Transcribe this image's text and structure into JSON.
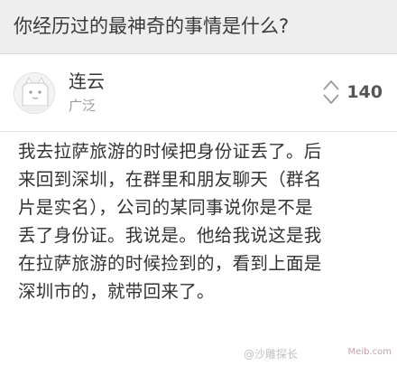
{
  "question": {
    "title": "你经历过的最神奇的事情是什么?"
  },
  "answer": {
    "author": {
      "name": "连云",
      "location": "广泛",
      "avatar_icon": "default-avatar-icon"
    },
    "votes": {
      "count": "140",
      "icon": "vote-up-down-icon"
    },
    "body_lines": [
      "我去拉萨旅游的时候把身份证丢了。后",
      "来回到深圳，在群里和朋友聊天（群名",
      "片是实名），公司的某同事说你是不是",
      "丢了身份证。我说是。他给我说这是我",
      "在拉萨旅游的时候捡到的，看到上面是",
      "深圳市的，就带回来了。"
    ]
  },
  "watermark": {
    "text": "@沙雕探长"
  },
  "corner_mark": {
    "text": "Meib.com"
  }
}
